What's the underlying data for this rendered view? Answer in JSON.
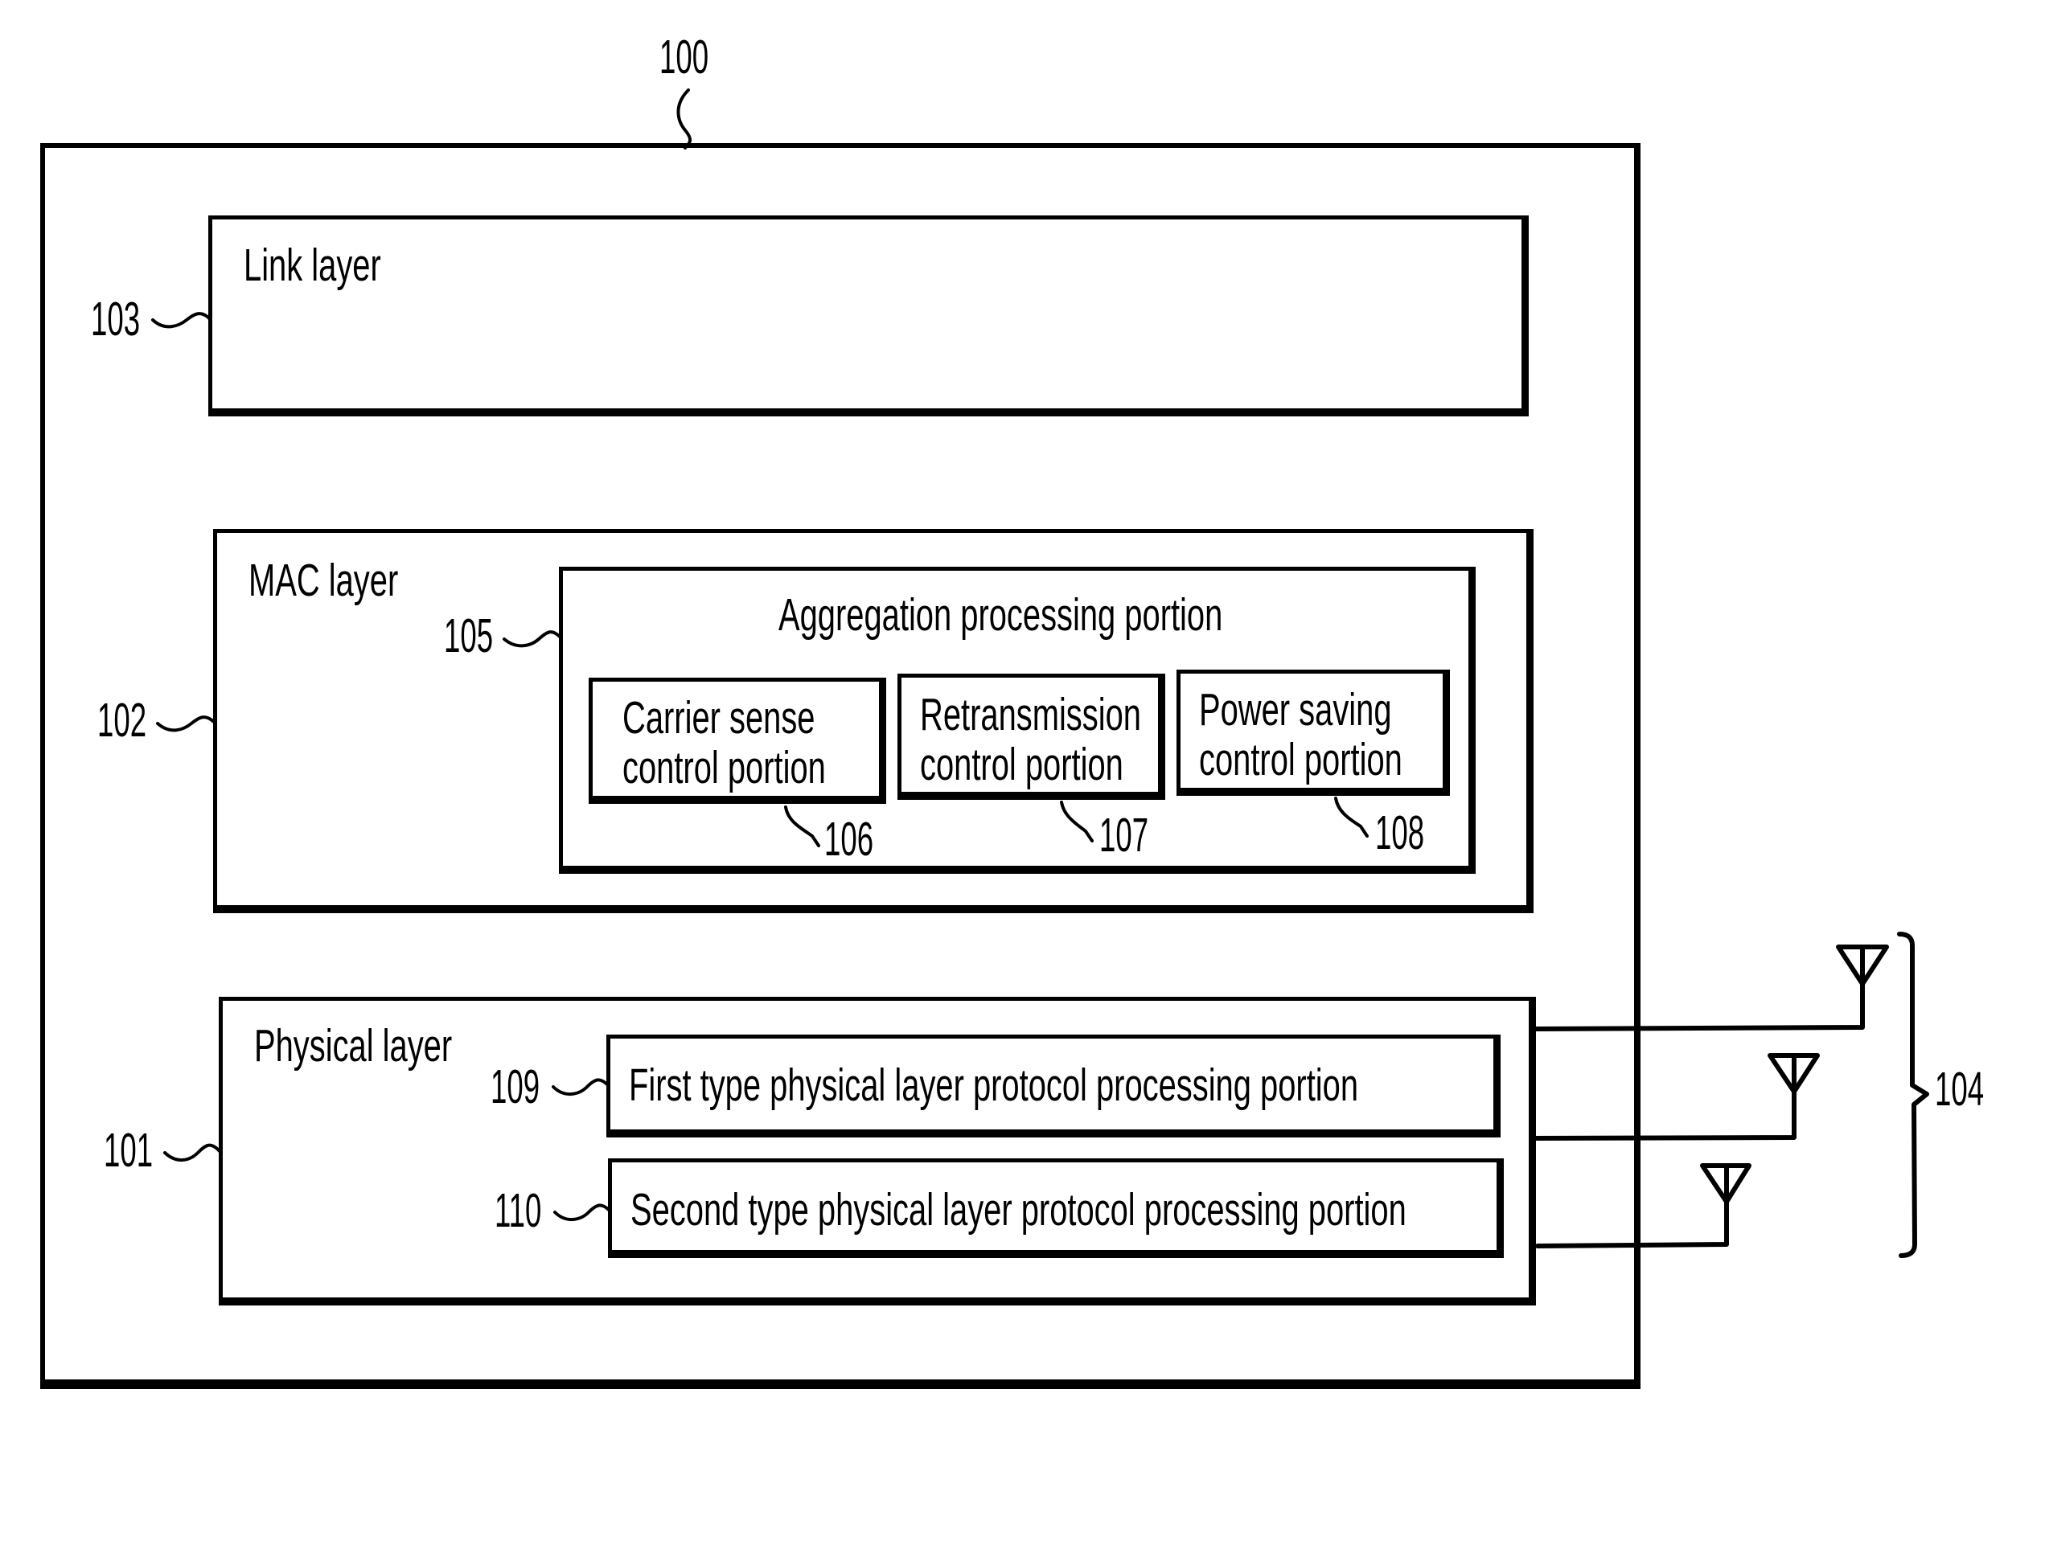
{
  "figure": {
    "reference_numerals": {
      "device": "100",
      "physical_layer": "101",
      "mac_layer": "102",
      "link_layer": "103",
      "antennas": "104",
      "aggregation": "105",
      "carrier_sense": "106",
      "retransmission": "107",
      "power_saving": "108",
      "first_phy": "109",
      "second_phy": "110"
    },
    "blocks": {
      "link_layer": {
        "label": "Link layer"
      },
      "mac_layer": {
        "label": "MAC layer",
        "aggregation": {
          "label": "Aggregation processing portion",
          "portions": [
            {
              "line1": "Carrier sense",
              "line2": "control portion"
            },
            {
              "line1": "Retransmission",
              "line2": "control portion"
            },
            {
              "line1": "Power saving",
              "line2": "control portion"
            }
          ]
        }
      },
      "physical_layer": {
        "label": "Physical layer",
        "portions": [
          {
            "label": "First type physical layer protocol processing portion"
          },
          {
            "label": "Second type physical layer protocol processing portion"
          }
        ]
      }
    },
    "antenna_icon": "antenna-icon",
    "antenna_count": 3
  }
}
